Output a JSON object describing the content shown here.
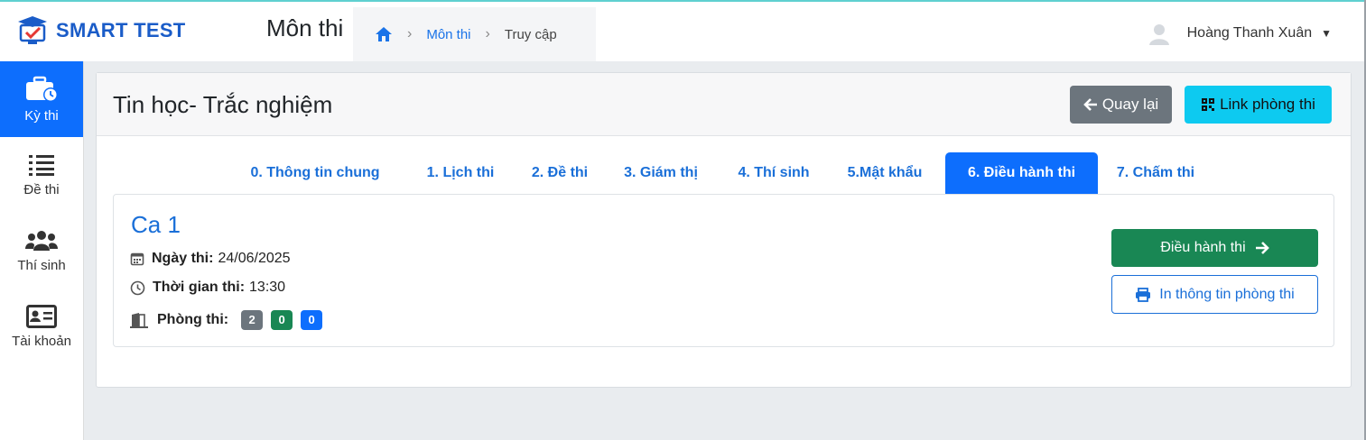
{
  "brand": {
    "name": "SMART TEST"
  },
  "header": {
    "title": "Môn thi",
    "breadcrumb": {
      "home_icon": "home-icon",
      "link": "Môn thi",
      "current": "Truy cập"
    },
    "user": {
      "name": "Hoàng Thanh Xuân",
      "caret": "▼"
    }
  },
  "sidebar": {
    "items": [
      {
        "label": "Kỳ thi",
        "icon": "briefcase-clock-icon",
        "active": true
      },
      {
        "label": "Đề thi",
        "icon": "list-icon",
        "active": false
      },
      {
        "label": "Thí sinh",
        "icon": "users-icon",
        "active": false
      },
      {
        "label": "Tài khoản",
        "icon": "id-card-icon",
        "active": false
      }
    ]
  },
  "card": {
    "title": "Tin học- Trắc nghiệm",
    "back_label": "Quay lại",
    "link_label": "Link phòng thi"
  },
  "tabs": [
    {
      "label": "0. Thông tin chung"
    },
    {
      "label": "1. Lịch thi"
    },
    {
      "label": "2. Đề thi"
    },
    {
      "label": "3. Giám thị"
    },
    {
      "label": "4. Thí sinh"
    },
    {
      "label": "5.Mật khẩu"
    },
    {
      "label": "6. Điều hành thi",
      "active": true
    },
    {
      "label": "7. Chấm thi"
    }
  ],
  "session": {
    "name": "Ca 1",
    "date_label": "Ngày thi:",
    "date_value": "24/06/2025",
    "time_label": "Thời gian thi:",
    "time_value": "13:30",
    "room_label": "Phòng thi:",
    "room_badges": [
      "2",
      "0",
      "0"
    ],
    "run_label": "Điều hành thi",
    "print_label": "In thông tin phòng thi"
  },
  "colors": {
    "primary": "#0d6efd",
    "success": "#198754",
    "secondary": "#6c757d",
    "info": "#0dcaf0"
  }
}
